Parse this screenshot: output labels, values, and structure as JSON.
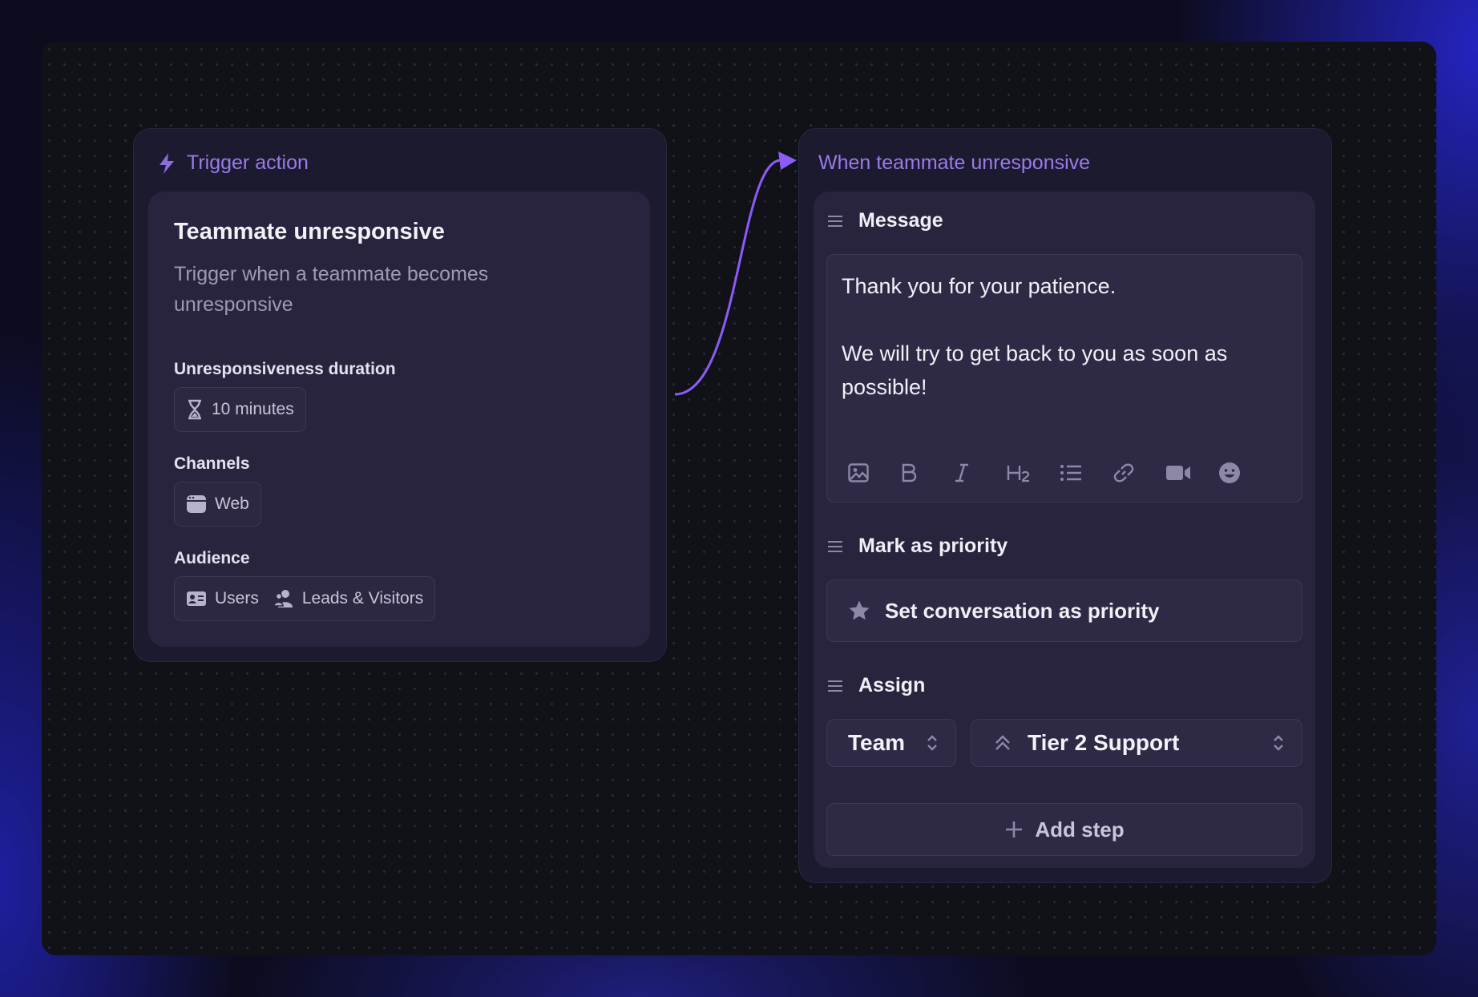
{
  "trigger_node": {
    "title": "Trigger action",
    "card": {
      "heading": "Teammate unresponsive",
      "description": "Trigger when a teammate becomes unresponsive",
      "duration_label": "Unresponsiveness duration",
      "duration_value": "10 minutes",
      "channels_label": "Channels",
      "channel": "Web",
      "audience_label": "Audience",
      "audience": [
        "Users",
        "Leads & Visitors"
      ]
    }
  },
  "action_node": {
    "title": "When teammate unresponsive",
    "message": {
      "heading": "Message",
      "text": "Thank you for your patience.\n\nWe will try to get back to you as soon as possible!",
      "toolbar_icons": [
        "image-icon",
        "bold-icon",
        "italic-icon",
        "heading-2-icon",
        "bullet-list-icon",
        "link-icon",
        "video-icon",
        "emoji-icon"
      ]
    },
    "priority": {
      "heading": "Mark as priority",
      "option": "Set conversation as priority"
    },
    "assign": {
      "heading": "Assign",
      "type": "Team",
      "target": "Tier 2 Support"
    },
    "add_step": "Add step"
  },
  "colors": {
    "accent": "#9b7bea",
    "connector": "#8b5cf6",
    "node_bg": "#1c1a2e",
    "card_bg": "#28243e"
  }
}
